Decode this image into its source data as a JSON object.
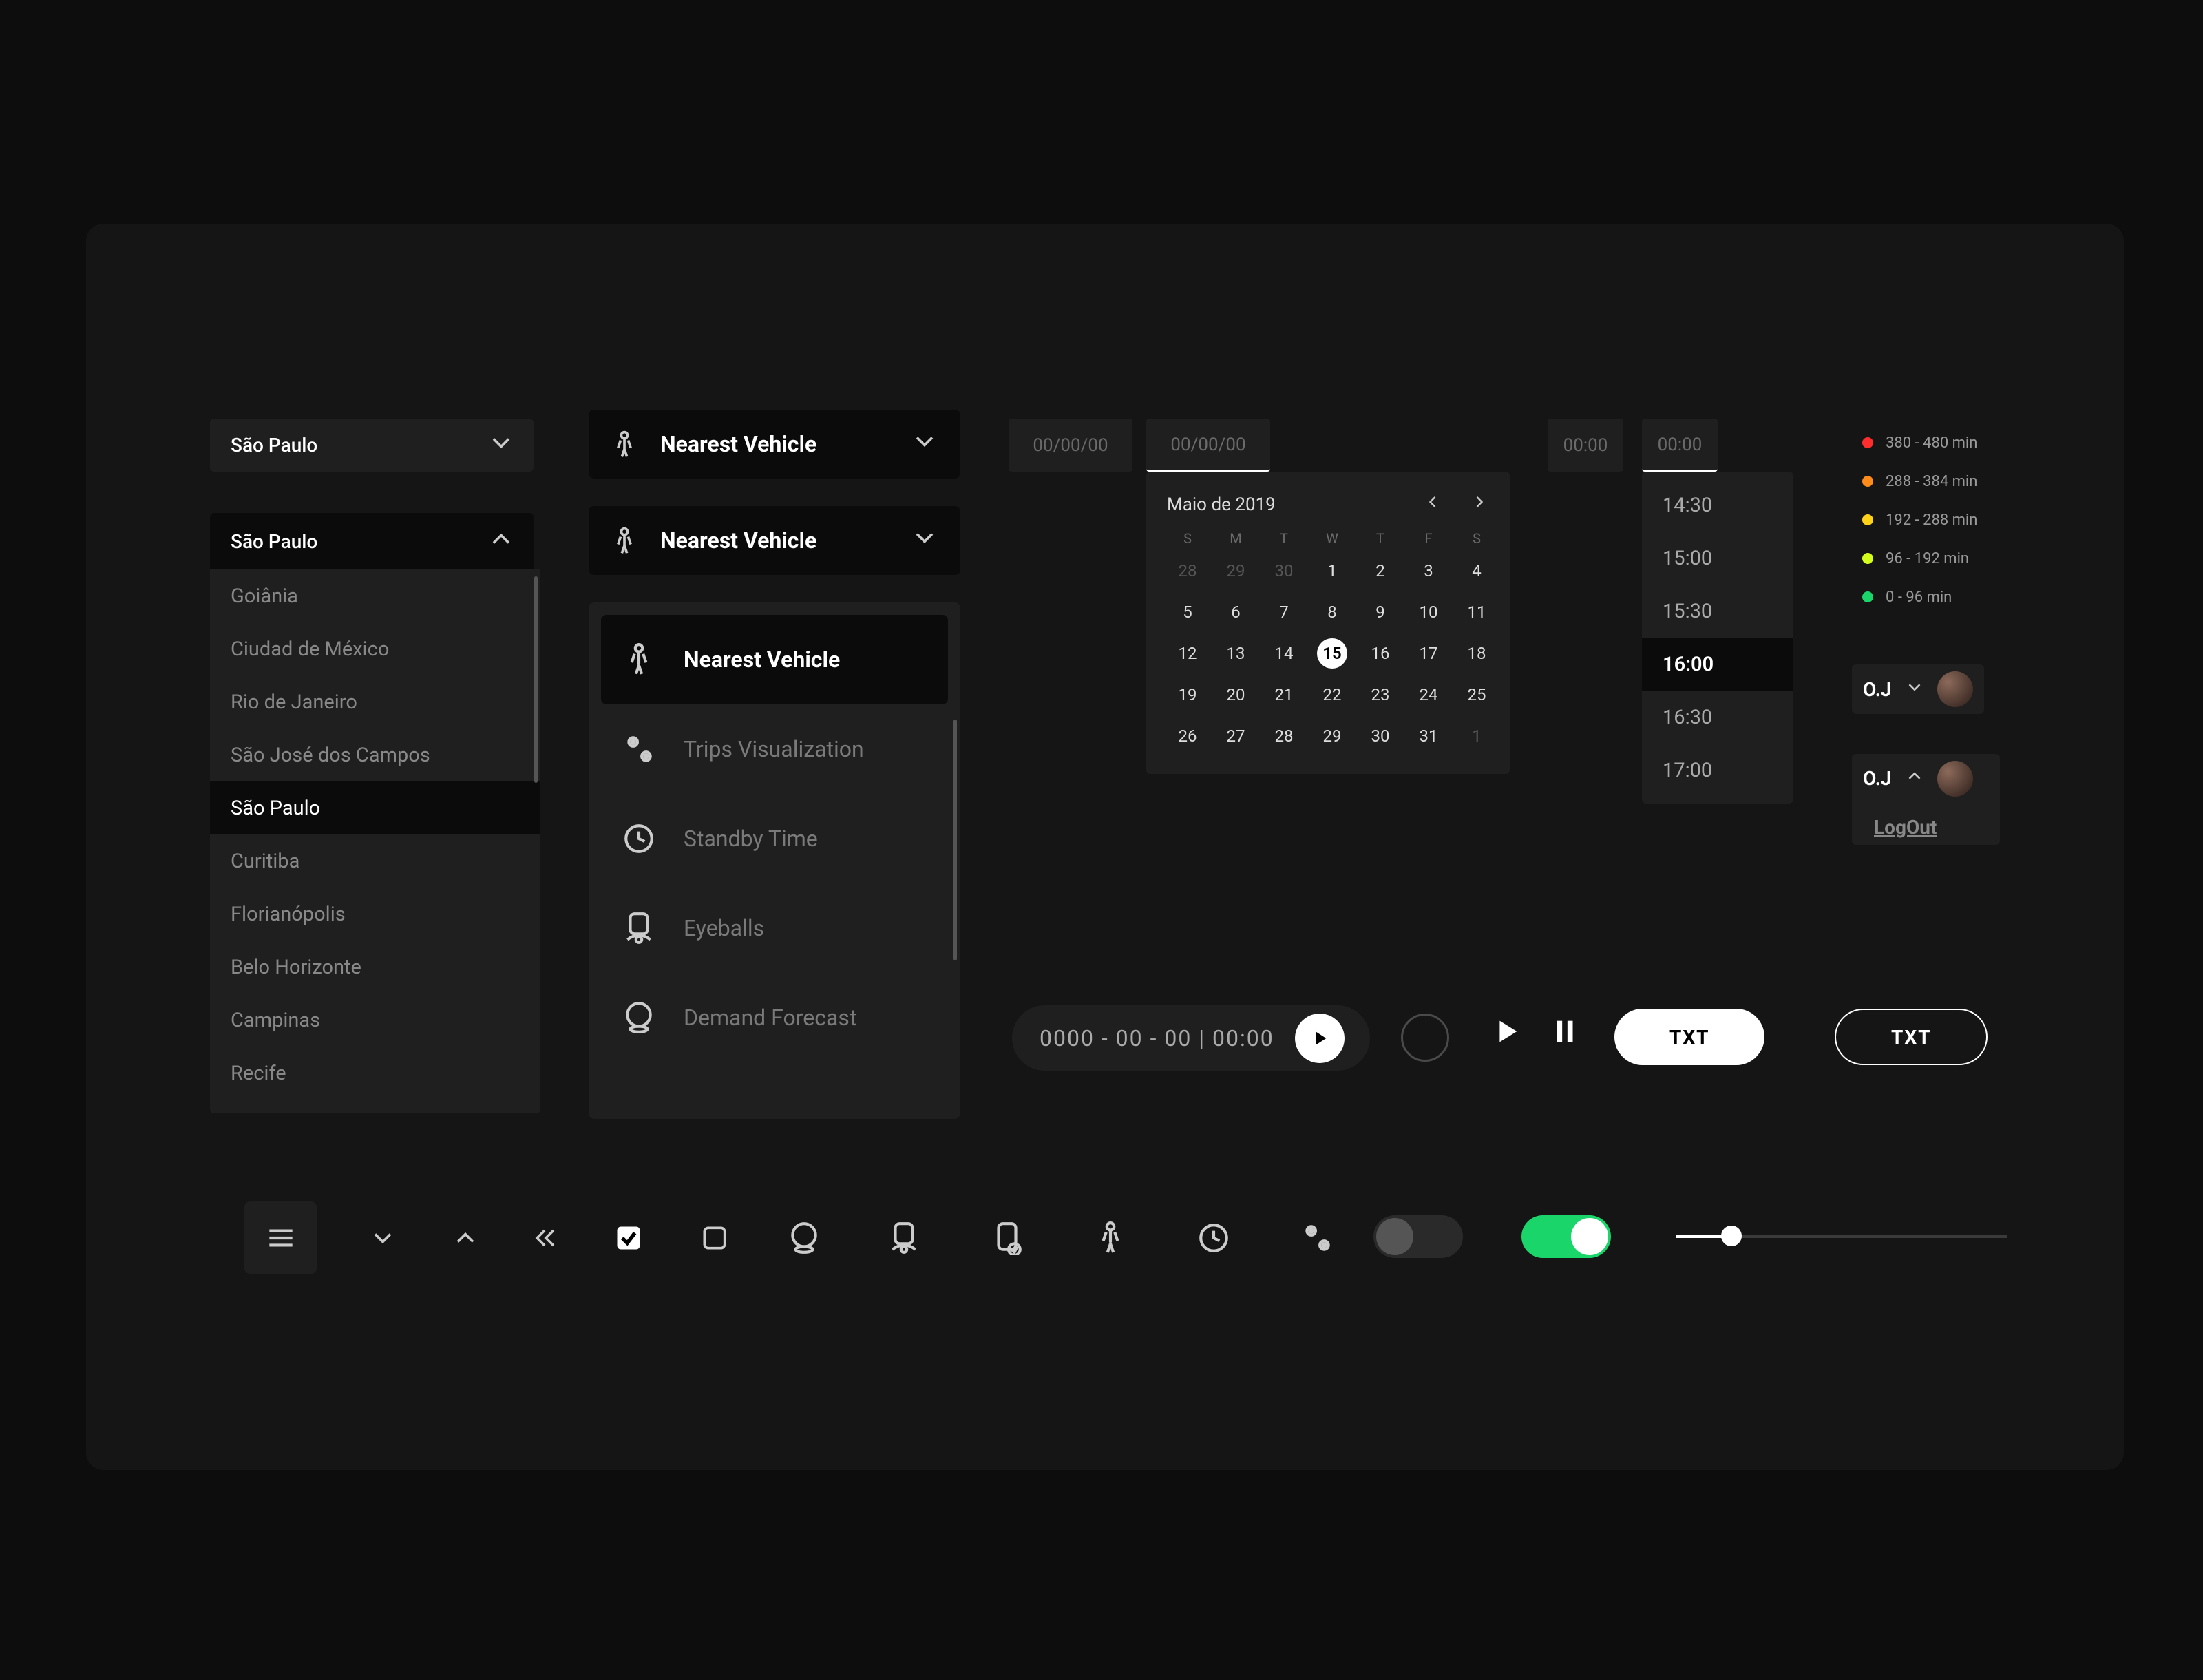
{
  "citySelect": {
    "collapsed": "São Paulo",
    "open": "São Paulo",
    "items": [
      "Goiânia",
      "Ciudad de México",
      "Rio de Janeiro",
      "São José dos Campos",
      "São Paulo",
      "Curitiba",
      "Florianópolis",
      "Belo Horizonte",
      "Campinas",
      "Recife"
    ],
    "selected": "São Paulo"
  },
  "nvSelect": {
    "collapsed1": "Nearest Vehicle",
    "collapsed2": "Nearest Vehicle",
    "items": [
      "Nearest Vehicle",
      "Trips Visualization",
      "Standby Time",
      "Eyeballs",
      "Demand Forecast"
    ],
    "selected": "Nearest Vehicle"
  },
  "dateInputs": {
    "date1": "00/00/00",
    "date2": "00/00/00",
    "time1": "00:00",
    "time2": "00:00"
  },
  "calendar": {
    "title": "Maio de 2019",
    "dow": [
      "S",
      "M",
      "T",
      "W",
      "T",
      "F",
      "S"
    ],
    "leading": [
      "28",
      "29",
      "30"
    ],
    "days": [
      "1",
      "2",
      "3",
      "4",
      "5",
      "6",
      "7",
      "8",
      "9",
      "10",
      "11",
      "12",
      "13",
      "14",
      "15",
      "16",
      "17",
      "18",
      "19",
      "20",
      "21",
      "22",
      "23",
      "24",
      "25",
      "26",
      "27",
      "28",
      "29",
      "30",
      "31"
    ],
    "trailing": [
      "1"
    ],
    "selected": "15"
  },
  "timeList": {
    "items": [
      "14:30",
      "15:00",
      "15:30",
      "16:00",
      "16:30",
      "17:00"
    ],
    "selected": "16:00"
  },
  "legend": {
    "rows": [
      {
        "color": "#ff2e2e",
        "label": "380 - 480 min"
      },
      {
        "color": "#ff8c1a",
        "label": "288 - 384 min"
      },
      {
        "color": "#ffd21a",
        "label": "192 - 288 min"
      },
      {
        "color": "#d4ff1a",
        "label": "96 - 192 min"
      },
      {
        "color": "#1ad66a",
        "label": "0 - 96 min"
      }
    ]
  },
  "user": {
    "initials": "O.J",
    "logout": "LogOut"
  },
  "playback": {
    "timestamp": "0000 - 00 - 00 | 00:00"
  },
  "buttons": {
    "txt1": "TXT",
    "txt2": "TXT"
  }
}
